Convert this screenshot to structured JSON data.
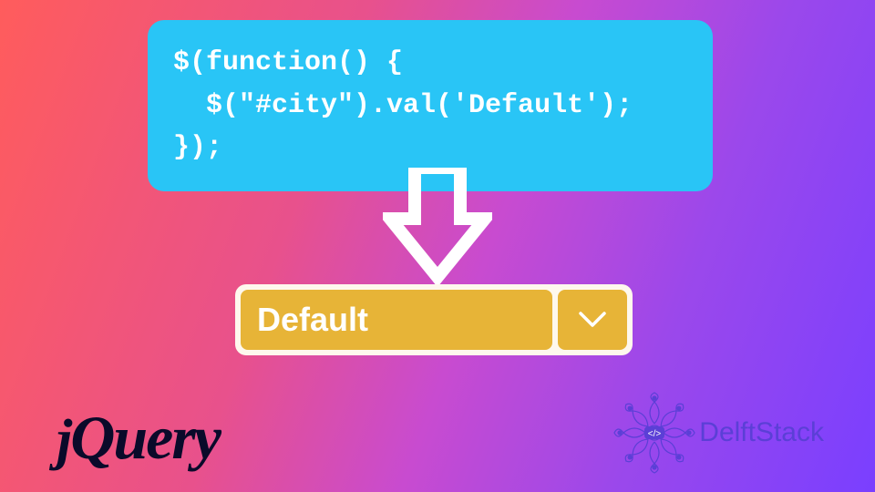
{
  "code": {
    "line1": "$(function() {",
    "line2": "  $(\"#city\").val('Default');",
    "line3": "});"
  },
  "dropdown": {
    "label": "Default"
  },
  "logos": {
    "jquery_j": "j",
    "jquery_query": "Query",
    "delftstack": "DelftStack"
  },
  "colors": {
    "code_bg": "#29c5f6",
    "dropdown_bg": "#e7b437",
    "dropdown_container": "#fef8ed",
    "delft_purple": "#5b3fd6"
  }
}
